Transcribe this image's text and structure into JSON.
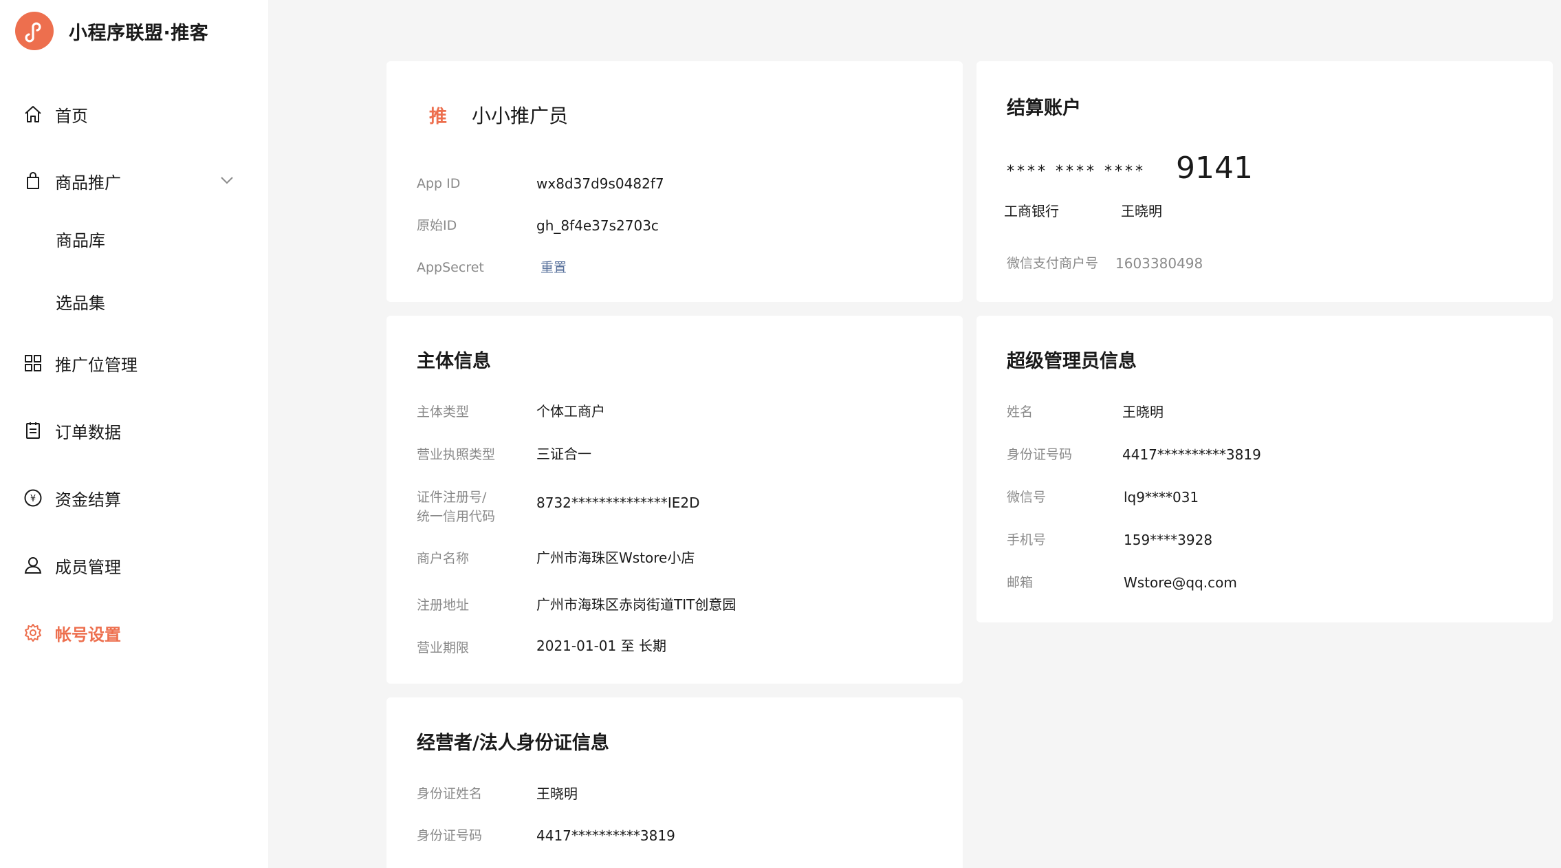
{
  "app": {
    "title": "小程序联盟·推客",
    "brand_color": "#ed6f4e"
  },
  "sidebar": {
    "items": [
      {
        "label": "首页",
        "icon": "home-icon"
      },
      {
        "label": "商品推广",
        "icon": "shopping-bag-icon",
        "expanded": true,
        "children": [
          {
            "label": "商品库"
          },
          {
            "label": "选品集"
          }
        ]
      },
      {
        "label": "推广位管理",
        "icon": "grid-icon"
      },
      {
        "label": "订单数据",
        "icon": "clipboard-icon"
      },
      {
        "label": "资金结算",
        "icon": "yen-circle-icon"
      },
      {
        "label": "成员管理",
        "icon": "user-icon"
      },
      {
        "label": "帐号设置",
        "icon": "gear-icon",
        "active": true
      }
    ]
  },
  "account_card": {
    "badge": "推",
    "name": "小小推广员",
    "rows": [
      {
        "label": "App ID",
        "value": "wx8d37d9s0482f7"
      },
      {
        "label": "原始ID",
        "value": "gh_8f4e37s2703c"
      },
      {
        "label": "AppSecret",
        "value": "重置"
      }
    ]
  },
  "settlement_card": {
    "title": "结算账户",
    "masked": "**** **** ****",
    "last4": "9141",
    "bank": "工商银行",
    "holder": "王晓明",
    "merchant_label": "微信支付商户号",
    "merchant_value": "1603380498"
  },
  "entity_card": {
    "title": "主体信息",
    "rows": [
      {
        "label": "主体类型",
        "value": "个体工商户"
      },
      {
        "label": "营业执照类型",
        "value": "三证合一"
      },
      {
        "label": "证件注册号/",
        "label2": "统一信用代码",
        "value": "8732**************IE2D"
      },
      {
        "label": "商户名称",
        "value": "广州市海珠区Wstore小店"
      },
      {
        "label": "注册地址",
        "value": "广州市海珠区赤岗街道TIT创意园"
      },
      {
        "label": "营业期限",
        "value": "2021-01-01 至 长期"
      }
    ]
  },
  "admin_card": {
    "title": "超级管理员信息",
    "rows": [
      {
        "label": "姓名",
        "value": "王晓明"
      },
      {
        "label": "身份证号码",
        "value": "4417**********3819"
      },
      {
        "label": "微信号",
        "value": "lq9****031"
      },
      {
        "label": "手机号",
        "value": "159****3928"
      },
      {
        "label": "邮箱",
        "value": "Wstore@qq.com"
      }
    ]
  },
  "legal_card": {
    "title": "经营者/法人身份证信息",
    "rows": [
      {
        "label": "身份证姓名",
        "value": "王晓明"
      },
      {
        "label": "身份证号码",
        "value": "4417**********3819"
      }
    ]
  }
}
